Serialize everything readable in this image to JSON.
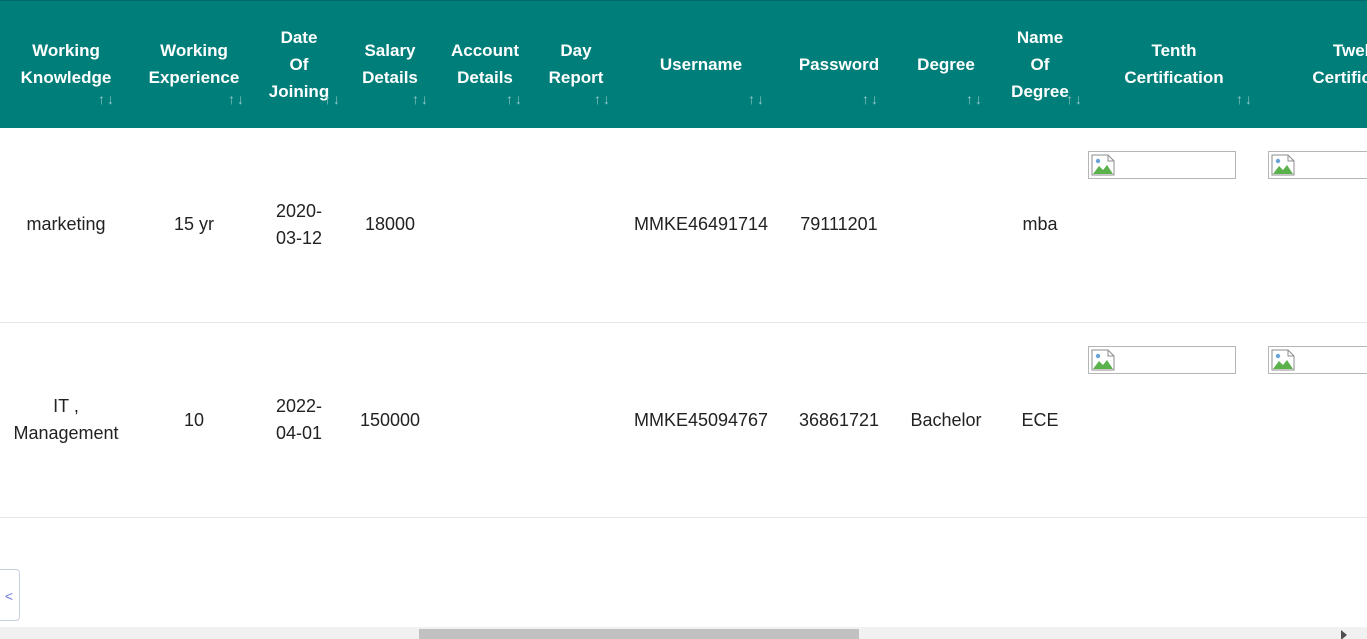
{
  "table": {
    "sort_icon": "↑↓",
    "columns": [
      {
        "key": "working_knowledge",
        "label": "Working\nKnowledge"
      },
      {
        "key": "working_experience",
        "label": "Working\nExperience"
      },
      {
        "key": "date_of_joining",
        "label": "Date\nOf\nJoining"
      },
      {
        "key": "salary_details",
        "label": "Salary\nDetails"
      },
      {
        "key": "account_details",
        "label": "Account\nDetails"
      },
      {
        "key": "day_report",
        "label": "Day\nReport"
      },
      {
        "key": "username",
        "label": "Username"
      },
      {
        "key": "password",
        "label": "Password"
      },
      {
        "key": "degree",
        "label": "Degree"
      },
      {
        "key": "name_of_degree",
        "label": "Name\nOf\nDegree"
      },
      {
        "key": "tenth_certification",
        "label": "Tenth\nCertification"
      },
      {
        "key": "twelfth_certification",
        "label": "Twelfth\nCertification"
      }
    ],
    "rows": [
      {
        "working_knowledge": "marketing",
        "working_experience": "15 yr",
        "date_of_joining": "2020-\n03-12",
        "salary_details": "18000",
        "account_details": "",
        "day_report": "",
        "username": "MMKE46491714",
        "password": "79111201",
        "degree": "",
        "name_of_degree": "mba",
        "tenth_certification": "broken-image-icon",
        "twelfth_certification": "broken-image-icon"
      },
      {
        "working_knowledge": "IT ,\nManagement",
        "working_experience": "10",
        "date_of_joining": "2022-\n04-01",
        "salary_details": "150000",
        "account_details": "",
        "day_report": "",
        "username": "MMKE45094767",
        "password": "36861721",
        "degree": "Bachelor",
        "name_of_degree": "ECE",
        "tenth_certification": "broken-image-icon",
        "twelfth_certification": "broken-image-icon"
      }
    ]
  },
  "pagination": {
    "prev_label": "<"
  },
  "colors": {
    "header_bg": "#007f7a",
    "header_text": "#ffffff",
    "sort_icon": "#8fc7c4",
    "row_divider": "#e6e6e6"
  }
}
